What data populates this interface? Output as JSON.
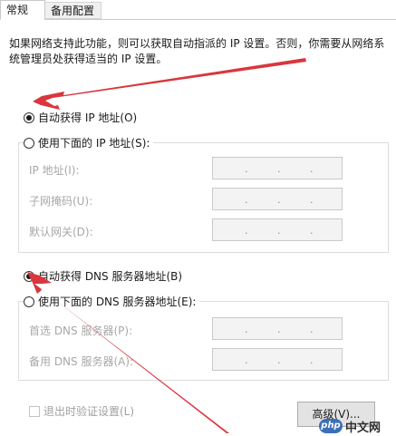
{
  "tabs": {
    "general": "常规",
    "alternate": "备用配置"
  },
  "description": "如果网络支持此功能，则可以获取自动指派的 IP 设置。否则，你需要从网络系统管理员处获得适当的 IP 设置。",
  "ip": {
    "auto_label": "自动获得 IP 地址(O)",
    "auto_checked": true,
    "manual_label": "使用下面的 IP 地址(S):",
    "manual_checked": false,
    "fields": {
      "address_label": "IP 地址(I):",
      "mask_label": "子网掩码(U):",
      "gateway_label": "默认网关(D):"
    }
  },
  "dns": {
    "auto_label": "自动获得 DNS 服务器地址(B)",
    "auto_checked": true,
    "manual_label": "使用下面的 DNS 服务器地址(E):",
    "manual_checked": false,
    "fields": {
      "preferred_label": "首选 DNS 服务器(P):",
      "alternate_label": "备用 DNS 服务器(A):"
    }
  },
  "ip_dot": ".",
  "validate_label": "退出时验证设置(L)",
  "advanced_label": "高级(V)...",
  "watermark": {
    "logo": "php",
    "text": "中文网"
  },
  "colors": {
    "arrow": "#d9363e",
    "disabled_text": "#a8a8a8"
  }
}
